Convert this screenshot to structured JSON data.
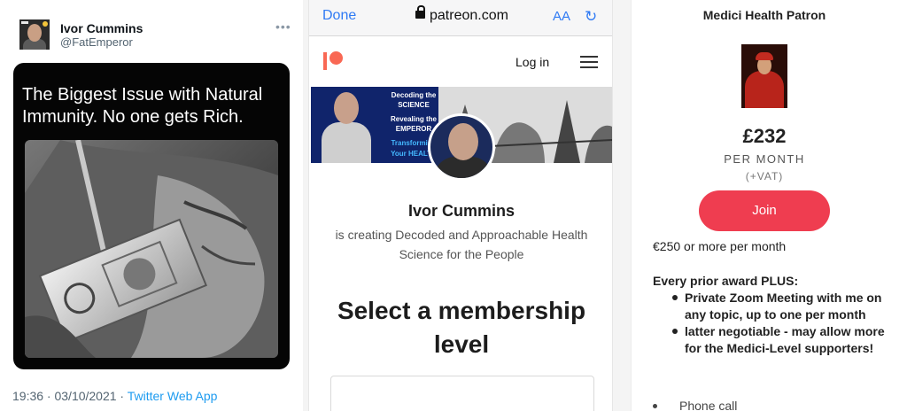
{
  "twitter": {
    "name": "Ivor Cummins",
    "handle": "@FatEmperor",
    "more_glyph": "•••",
    "caption": "The Biggest Issue with Natural Immunity. No one gets Rich.",
    "timestamp": "19:36 · 03/10/2021 · ",
    "app": "Twitter Web App"
  },
  "safari": {
    "done": "Done",
    "domain": "patreon.com",
    "text_size": "AA",
    "reload_glyph": "↻"
  },
  "patreon": {
    "login": "Log in",
    "cover": {
      "line1": "Decoding the",
      "line2": "SCIENCE",
      "line3": "Revealing the",
      "line4": "EMPEROR",
      "line5": "Transforming",
      "line6": "Your HEALTH"
    },
    "creator_name": "Ivor Cummins",
    "tagline": "is creating Decoded and Approachable Health Science for the People",
    "heading": "Select a membership level"
  },
  "tier": {
    "title": "Medici Health Patron",
    "price": "£232",
    "period": "PER MONTH",
    "vat": "(+VAT)",
    "join": "Join",
    "minimum": "€250 or more per month",
    "benefits_heading": "Every prior award PLUS:",
    "benefits": [
      "Private Zoom Meeting with me on any topic, up to one per month",
      "latter negotiable - may allow more for the Medici-Level supporters!"
    ],
    "extra": "Phone call"
  },
  "colors": {
    "twitter_blue": "#1d9bf0",
    "patreon_coral": "#f96854",
    "join_red": "#ef3d50",
    "safari_blue": "#2f7af4"
  }
}
